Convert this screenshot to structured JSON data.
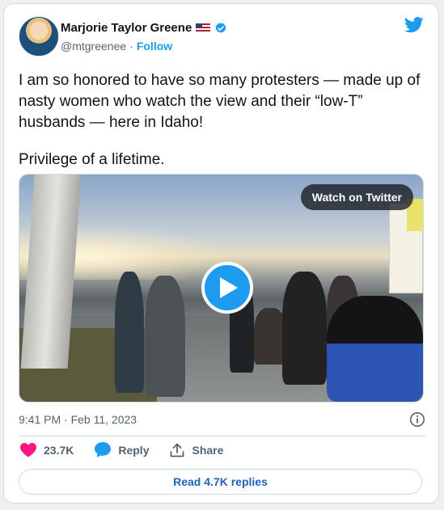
{
  "author": {
    "name": "Marjorie Taylor Greene",
    "handle": "@mtgreenee",
    "separator": "·",
    "follow_label": "Follow"
  },
  "tweet": {
    "paragraphs": [
      "I am so honored to have so many protesters — made up of nasty women who watch the view and their “low-T” husbands — here in Idaho!",
      "Privilege of a lifetime."
    ],
    "timestamp": "9:41 PM · Feb 11, 2023"
  },
  "media": {
    "watch_label": "Watch on Twitter"
  },
  "actions": {
    "likes": "23.7K",
    "reply_label": "Reply",
    "share_label": "Share"
  },
  "replies": {
    "label": "Read 4.7K replies"
  },
  "colors": {
    "accent": "#1d9bf0",
    "like": "#f91880",
    "text": "#0f1419",
    "muted": "#536471"
  },
  "icons": [
    "us-flag-icon",
    "verified-badge-icon",
    "twitter-bird-icon",
    "play-icon",
    "info-icon",
    "heart-icon",
    "reply-bubble-icon",
    "share-icon"
  ]
}
